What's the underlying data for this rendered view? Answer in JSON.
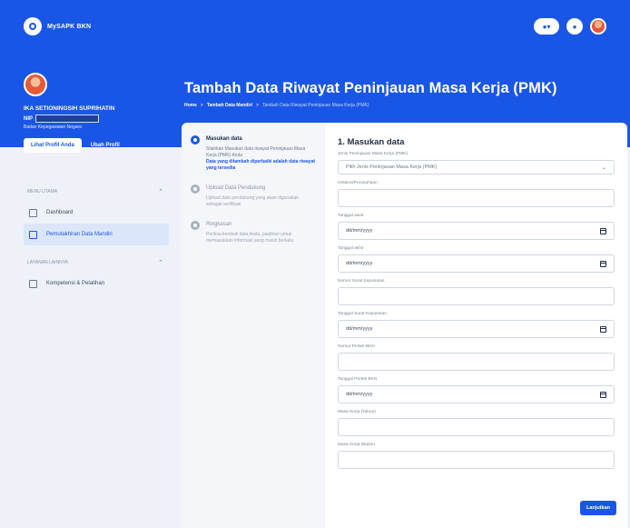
{
  "app": {
    "brand": "MySAPK BKN"
  },
  "profile": {
    "name": "IKA SETIONINGSIH SUPRIHATIN",
    "nip_label": "NIP",
    "org": "Badan Kepegawaian Negara",
    "view_button": "Lihat Profil Anda",
    "edit_button": "Ubah Profil"
  },
  "sidebar": {
    "section1": "MENU UTAMA",
    "items1": [
      {
        "label": "Dashboard"
      },
      {
        "label": "Pemutakhiran Data Mandiri"
      }
    ],
    "section2": "LAYANAN LAINNYA",
    "items2": [
      {
        "label": "Kompetensi & Pelatihan"
      }
    ]
  },
  "header": {
    "title": "Tambah Data Riwayat Peninjauan Masa Kerja (PMK)",
    "breadcrumb": [
      "Home",
      "Tambah Data Mandiri",
      "Tambah Data Riwayat Peninjauan Masa Kerja (PMK)"
    ]
  },
  "steps": [
    {
      "title": "Masukan data",
      "desc": "Silahkan Masukan data riwayat Peninjauan Masa Kerja (PMK) Anda",
      "note": "Data yang ditambah diperbaiki adalah data riwayat yang tersedia"
    },
    {
      "title": "Upload Data Pendukung",
      "desc": "Upload data pendukung yang akan digunakan sebagai verifikasi",
      "note": ""
    },
    {
      "title": "Ringkasan",
      "desc": "Periksa kembali data Anda, pastikan untuk memasukkan informasi yang masih berlaku",
      "note": ""
    }
  ],
  "form": {
    "title": "1. Masukan data",
    "fields": [
      {
        "label": "Jenis Peninjauan Masa Kerja (PMK)",
        "value": "Pilih Jenis Peninjauan Masa Kerja (PMK)"
      },
      {
        "label": "Instansi/Perusahaan",
        "value": ""
      },
      {
        "label": "Tanggal awal",
        "value": "dd/mm/yyyy"
      },
      {
        "label": "Tanggal akhir",
        "value": "dd/mm/yyyy"
      },
      {
        "label": "Nomor Surat Keputusan",
        "value": ""
      },
      {
        "label": "Tanggal Surat Keputusan",
        "value": "dd/mm/yyyy"
      },
      {
        "label": "Nomor Pertek BKN",
        "value": ""
      },
      {
        "label": "Tanggal Pertek BKN",
        "value": "dd/mm/yyyy"
      },
      {
        "label": "Masa Kerja (Tahun)",
        "value": ""
      },
      {
        "label": "Masa Kerja (Bulan)",
        "value": ""
      }
    ],
    "next_button": "Lanjutkan"
  },
  "colors": {
    "primary": "#1a56e6",
    "background": "#eef2f8"
  }
}
